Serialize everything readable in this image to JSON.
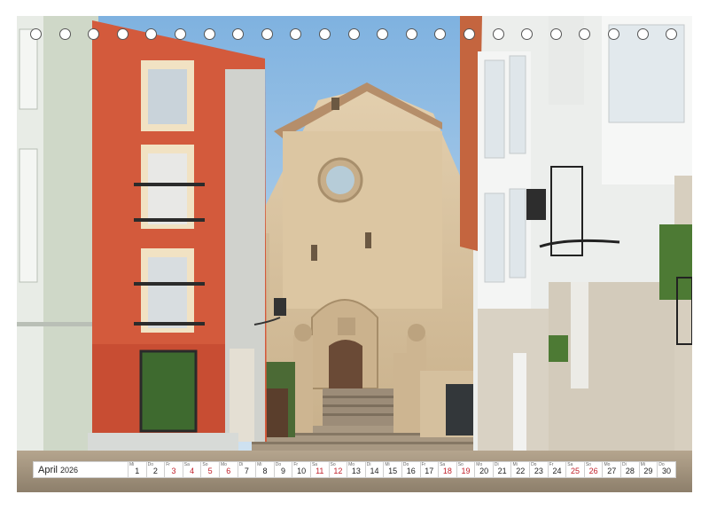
{
  "calendar": {
    "month": "April",
    "year": "2026",
    "days": [
      {
        "weekday": "Mi",
        "num": "1",
        "red": false
      },
      {
        "weekday": "Do",
        "num": "2",
        "red": false
      },
      {
        "weekday": "Fr",
        "num": "3",
        "red": true
      },
      {
        "weekday": "Sa",
        "num": "4",
        "red": true
      },
      {
        "weekday": "So",
        "num": "5",
        "red": true
      },
      {
        "weekday": "Mo",
        "num": "6",
        "red": true
      },
      {
        "weekday": "Di",
        "num": "7",
        "red": false
      },
      {
        "weekday": "Mi",
        "num": "8",
        "red": false
      },
      {
        "weekday": "Do",
        "num": "9",
        "red": false
      },
      {
        "weekday": "Fr",
        "num": "10",
        "red": false
      },
      {
        "weekday": "Sa",
        "num": "11",
        "red": true
      },
      {
        "weekday": "So",
        "num": "12",
        "red": true
      },
      {
        "weekday": "Mo",
        "num": "13",
        "red": false
      },
      {
        "weekday": "Di",
        "num": "14",
        "red": false
      },
      {
        "weekday": "Mi",
        "num": "15",
        "red": false
      },
      {
        "weekday": "Do",
        "num": "16",
        "red": false
      },
      {
        "weekday": "Fr",
        "num": "17",
        "red": false
      },
      {
        "weekday": "Sa",
        "num": "18",
        "red": true
      },
      {
        "weekday": "So",
        "num": "19",
        "red": true
      },
      {
        "weekday": "Mo",
        "num": "20",
        "red": false
      },
      {
        "weekday": "Di",
        "num": "21",
        "red": false
      },
      {
        "weekday": "Mi",
        "num": "22",
        "red": false
      },
      {
        "weekday": "Do",
        "num": "23",
        "red": false
      },
      {
        "weekday": "Fr",
        "num": "24",
        "red": false
      },
      {
        "weekday": "Sa",
        "num": "25",
        "red": true
      },
      {
        "weekday": "So",
        "num": "26",
        "red": true
      },
      {
        "weekday": "Mo",
        "num": "27",
        "red": false
      },
      {
        "weekday": "Di",
        "num": "28",
        "red": false
      },
      {
        "weekday": "Mi",
        "num": "29",
        "red": false
      },
      {
        "weekday": "Do",
        "num": "30",
        "red": false
      }
    ]
  },
  "binding_rings": 23,
  "colors": {
    "sky": "#a9cbe8",
    "stone": "#d9c3a0",
    "red_facade": "#d0583c",
    "white_facade": "#eef0ee",
    "holiday_red": "#c0202a"
  }
}
